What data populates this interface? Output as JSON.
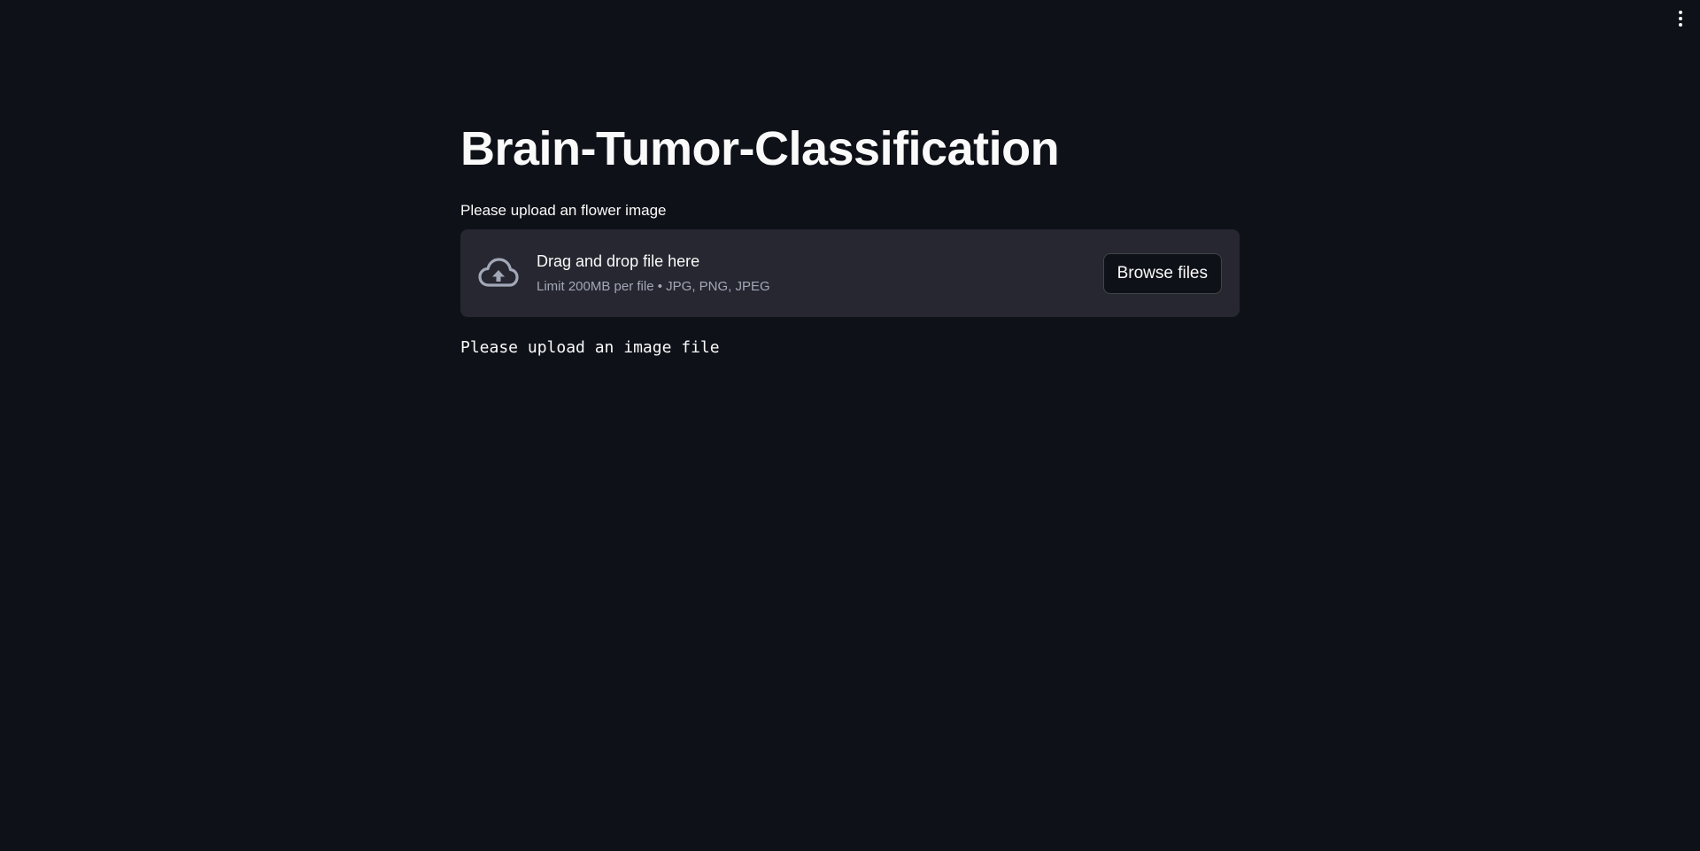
{
  "header": {
    "menu_icon": "kebab-menu-icon"
  },
  "main": {
    "title": "Brain-Tumor-Classification",
    "uploader": {
      "label": "Please upload an flower image",
      "icon": "cloud-upload-icon",
      "instructions": "Drag and drop file here",
      "limit_text": "Limit 200MB per file • JPG, PNG, JPEG",
      "browse_label": "Browse files"
    },
    "status_text": "Please upload an image file"
  },
  "colors": {
    "background": "#0e1117",
    "dropzone_bg": "#262730",
    "text": "#fafafa",
    "muted_text": "#a3a8b8"
  }
}
